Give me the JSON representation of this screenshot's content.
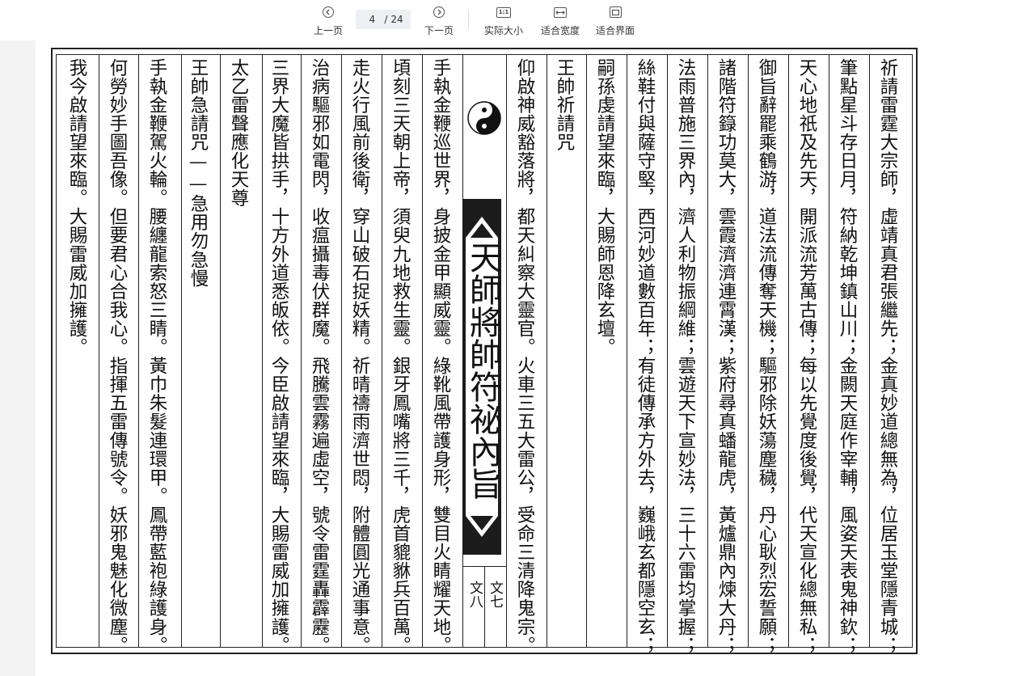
{
  "toolbar": {
    "prev_label": "上一页",
    "next_label": "下一页",
    "current_page": "4",
    "page_separator": "/",
    "total_pages": "24",
    "actual_size_label": "实际大小",
    "actual_size_icon_text": "1:1",
    "fit_width_label": "适合宽度",
    "fit_page_label": "适合界面",
    "icons": {
      "prev": "chevron-left-circle-icon",
      "next": "chevron-right-circle-icon",
      "actual_size": "one-to-one-icon",
      "fit_width": "fit-width-icon",
      "fit_page": "fit-page-icon"
    }
  },
  "document": {
    "title": "天師將帥符祕內旨",
    "page_markers": [
      "文七",
      "文八"
    ],
    "right_page_columns": [
      "祈請雷霆大宗師，虛靖真君張繼先；金真妙道總無為，位居玉堂隱青城；",
      "筆點星斗存日月，符納乾坤鎮山川；金闕天庭作宰輔，風姿天表鬼神欽；",
      "天心地祇及先天，開派流芳萬古傳；每以先覺度後覺，代天宣化總無私；",
      "御旨辭罷乘鶴游，道法流傳奪天機；驅邪除妖蕩塵穢，丹心耿烈宏誓願；",
      "諸階符籙功莫大，雲霞濟濟連霄漢；紫府尋真蟠龍虎，黃爐鼎內煉大丹；",
      "法雨普施三界內，濟人利物振綱維；雲遊天下宣妙法，三十六雷均掌握；",
      "絲鞋付與薩守堅，西河妙道數百年；有徒傳承方外去，巍峨玄都隱空玄；",
      "嗣孫虔請望來臨，大賜師恩降玄壇。",
      "王帥祈請咒",
      "仰啟神威豁落將，都天糾察大靈官。火車三五大雷公，受命三清降鬼宗。"
    ],
    "left_page_columns": [
      "手執金鞭巡世界，身披金甲顯威靈。綠靴風帶護身形，雙目火睛耀天地。",
      "頃刻三天朝上帝，須臾九地救生靈。銀牙鳳嘴將三千，虎首貔貅兵百萬。",
      "走火行風前後衛，穿山破石捉妖精。祈晴禱雨濟世悶，附體圓光通事意。",
      "治病驅邪如電閃，收瘟攝毒伏群魔。飛騰雲霧遍虛空，號令雷霆轟霹靂。",
      "三界大魔皆拱手，十方外道悉皈依。今臣啟請望來臨，大賜雷威加擁護。",
      "太乙雷聲應化天尊",
      "王帥急請咒——急用勿急慢",
      "手執金鞭駕火輪。腰纏龍索怒三睛。黃巾朱髮連環甲。鳳帶藍袍綠護身。",
      "何勞妙手圖吾像。但要君心合我心。指揮五雷傳號令。妖邪鬼魅化微塵。",
      "我今啟請望來臨。大賜雷威加擁護。"
    ]
  }
}
